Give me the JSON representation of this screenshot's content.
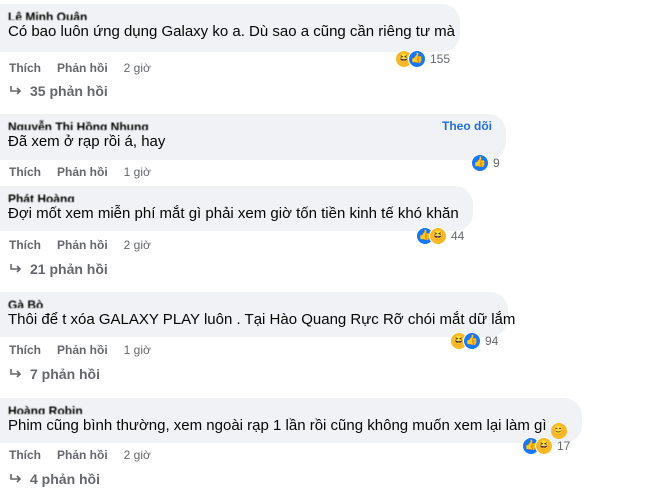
{
  "labels": {
    "like": "Thích",
    "reply": "Phản hồi"
  },
  "colors": {
    "bubble": "#f0f2f5",
    "meta": "#65676b",
    "like_blue": "#1877f2",
    "haha_yellow": "#f7b928",
    "follow_blue": "#216fdb"
  },
  "comments": [
    {
      "author": "Lê Minh Quân",
      "text": "Có bao luôn ứng dụng Galaxy ko a. Dù sao a cũng cần riêng tư mà",
      "time": "2 giờ",
      "reactions": [
        "haha",
        "like"
      ],
      "reaction_count": "155",
      "replies": "35 phản hồi"
    },
    {
      "author": "Nguyễn Thị Hồng Nhung",
      "text": "Đã xem ở rạp rồi á, hay",
      "follow": "Theo dõi",
      "time": "1 giờ",
      "reactions": [
        "like"
      ],
      "reaction_count": "9"
    },
    {
      "author": "Phát Hoàng",
      "text": "Đợi mốt xem miễn phí mắt gì phải xem giờ tốn tiền kinh tế khó khăn",
      "time": "2 giờ",
      "reactions": [
        "like",
        "haha"
      ],
      "reaction_count": "44",
      "replies": "21 phản hồi"
    },
    {
      "author": "Gà Bò",
      "text": "Thôi để t xóa GALAXY PLAY luôn . Tại Hào Quang Rực Rỡ chói mắt dữ lắm",
      "time": "1 giờ",
      "reactions": [
        "haha",
        "like"
      ],
      "reaction_count": "94",
      "replies": "7 phản hồi"
    },
    {
      "author": "Hoàng Robin",
      "text": "Phim cũng bình thường, xem ngoài rạp 1 lần rồi cũng không muốn xem lại làm gì",
      "time": "2 giờ",
      "reactions": [
        "like",
        "haha"
      ],
      "reaction_count": "17",
      "replies": "4 phản hồi",
      "trailing_emoji": "smile-emoji"
    }
  ]
}
